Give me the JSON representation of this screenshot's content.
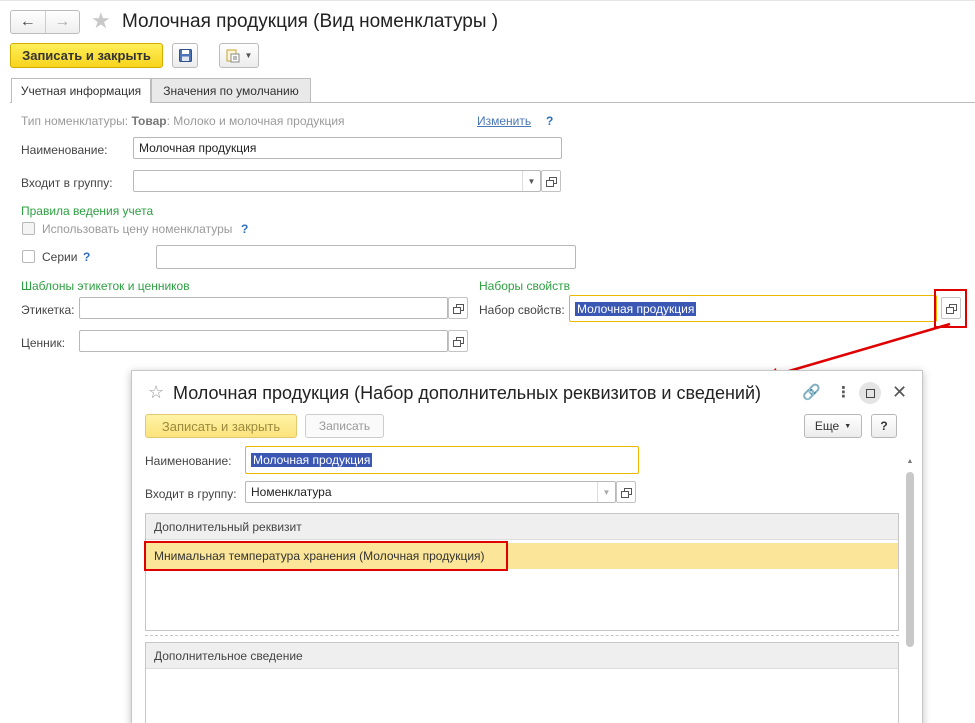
{
  "main": {
    "title": "Молочная продукция (Вид номенклатуры )",
    "nav": {
      "back": "←",
      "forward": "→"
    },
    "toolbar": {
      "save_close_label": "Записать и закрыть"
    },
    "tabs": [
      {
        "label": "Учетная информация",
        "active": true
      },
      {
        "label": "Значения по умолчанию",
        "active": false
      }
    ],
    "type_row": {
      "label": "Тип номенклатуры:",
      "value_bold": "Товар",
      "value_rest": ": Молоко и молочная продукция",
      "change_link": "Изменить",
      "help": "?"
    },
    "name": {
      "label": "Наименование:",
      "value": "Молочная продукция"
    },
    "group": {
      "label": "Входит в группу:",
      "value": ""
    },
    "rules_header": "Правила ведения учета",
    "use_price": {
      "label": "Использовать цену номенклатуры",
      "help": "?",
      "checked": false
    },
    "series": {
      "label": "Серии",
      "help": "?",
      "checked": false
    },
    "templates_header": "Шаблоны этикеток и ценников",
    "label_field": {
      "label": "Этикетка:",
      "value": ""
    },
    "price_tag_field": {
      "label": "Ценник:",
      "value": ""
    },
    "property_sets_header": "Наборы свойств",
    "property_set": {
      "label": "Набор свойств:",
      "value": "Молочная продукция"
    }
  },
  "popup": {
    "title": "Молочная продукция (Набор дополнительных реквизитов и сведений)",
    "save_close_label": "Записать и закрыть",
    "save_label": "Записать",
    "more_label": "Еще",
    "help_label": "?",
    "name": {
      "label": "Наименование:",
      "value": "Молочная продукция"
    },
    "group": {
      "label": "Входит в группу:",
      "value": "Номенклатура"
    },
    "attributes": {
      "header": "Дополнительный реквизит",
      "rows": [
        "Мнимальная температура хранения (Молочная продукция)"
      ]
    },
    "info": {
      "header": "Дополнительное сведение",
      "rows": []
    }
  },
  "colors": {
    "accent_yellow": "#f7d41c",
    "selection_blue": "#3a57b4",
    "section_green": "#2ea043",
    "highlight_red": "#e00000",
    "row_highlight": "#fbe598"
  }
}
